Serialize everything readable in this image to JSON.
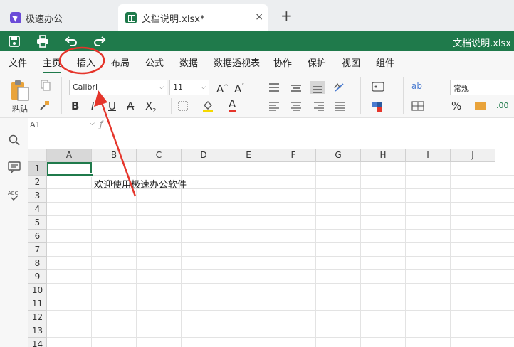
{
  "tabs": {
    "inactive_label": "极速办公",
    "active_label": "文档说明.xlsx*",
    "close_glyph": "×",
    "add_glyph": "+"
  },
  "toolbar": {
    "doc_title": "文档说明.xlsx",
    "icons": [
      "save-icon",
      "print-icon",
      "undo-icon",
      "redo-icon"
    ]
  },
  "menu": {
    "items": [
      "文件",
      "主页",
      "插入",
      "布局",
      "公式",
      "数据",
      "数据透视表",
      "协作",
      "保护",
      "视图",
      "组件"
    ],
    "active_index": 1,
    "highlighted_index": 2
  },
  "ribbon": {
    "paste_label": "粘贴",
    "font_name": "Calibri",
    "font_size": "11",
    "number_format": "常规"
  },
  "formula": {
    "cell_ref": "A1",
    "fx_glyph": "ƒ",
    "content": ""
  },
  "sheet": {
    "columns": [
      "A",
      "B",
      "C",
      "D",
      "E",
      "F",
      "G",
      "H",
      "I",
      "J"
    ],
    "rows": [
      "1",
      "2",
      "3",
      "4",
      "5",
      "6",
      "7",
      "8",
      "9",
      "10",
      "11",
      "12",
      "13",
      "14"
    ],
    "selected_cell": "A1",
    "cells": [
      {
        "ref": "B2",
        "value": "欢迎使用极速办公软件"
      }
    ]
  },
  "colors": {
    "accent": "#1f7a4b",
    "annotation": "#e5352b",
    "app_logo": "#6b4bd8"
  }
}
